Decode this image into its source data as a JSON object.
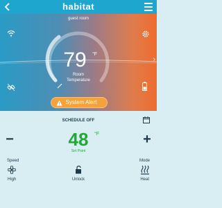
{
  "header": {
    "back_icon": "chevron-left-icon",
    "brand": "habitat",
    "menu_icon": "hamburger-menu-icon",
    "color": "#1fa6cf"
  },
  "hero": {
    "room_name": "guest room",
    "temperature": "79",
    "unit": "°F",
    "label_line1": "Room",
    "label_line2": "Temperature",
    "alert_label": "System Alert",
    "alert_color": "#f5a23a",
    "icons": [
      "wifi-icon",
      "gear-icon",
      "link-icon",
      "pencil-icon",
      "battery-icon",
      "arrow-right-icon",
      "warning-icon"
    ]
  },
  "control": {
    "schedule_label": "SCHEDULE OFF",
    "set_point": "48",
    "unit": "°F",
    "set_point_label": "Set Point",
    "decrease": "−",
    "increase": "+",
    "set_point_color": "#1faa35"
  },
  "footer": {
    "speed_label": "Speed",
    "speed_value": "High",
    "lock_value": "Unlock",
    "mode_label": "Mode",
    "mode_value": "Heat",
    "icons": [
      "fan-icon",
      "lock-icon",
      "heat-icon",
      "calendar-icon"
    ]
  }
}
